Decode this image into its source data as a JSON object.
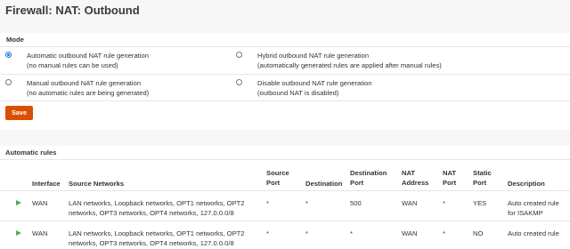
{
  "page": {
    "title": "Firewall: NAT: Outbound"
  },
  "mode": {
    "heading": "Mode",
    "options": [
      {
        "line1": "Automatic outbound NAT rule generation",
        "line2": "(no manual rules can be used)",
        "checked": true
      },
      {
        "line1": "Hybrid outbound NAT rule generation",
        "line2": "(automatically generated rules are applied after manual rules)",
        "checked": false
      },
      {
        "line1": "Manual outbound NAT rule generation",
        "line2": "(no automatic rules are being generated)",
        "checked": false
      },
      {
        "line1": "Disable outbound NAT rule generation",
        "line2": "(outbound NAT is disabled)",
        "checked": false
      }
    ],
    "save_label": "Save"
  },
  "rules": {
    "heading": "Automatic rules",
    "columns": {
      "interface": "Interface",
      "source_networks": "Source Networks",
      "source_port_1": "Source",
      "source_port_2": "Port",
      "destination": "Destination",
      "destination_port_1": "Destination",
      "destination_port_2": "Port",
      "nat_address_1": "NAT",
      "nat_address_2": "Address",
      "nat_port_1": "NAT",
      "nat_port_2": "Port",
      "static_port_1": "Static",
      "static_port_2": "Port",
      "description": "Description"
    },
    "rows": [
      {
        "interface": "WAN",
        "source_line1": "LAN networks, Loopback networks, OPT1 networks, OPT2",
        "source_line2": "networks, OPT3 networks, OPT4 networks, 127.0.0.0/8",
        "source_port": "*",
        "destination": "*",
        "destination_port": "500",
        "nat_address": "WAN",
        "nat_port": "*",
        "static_port": "YES",
        "description_line1": "Auto created rule",
        "description_line2": "for ISAKMP"
      },
      {
        "interface": "WAN",
        "source_line1": "LAN networks, Loopback networks, OPT1 networks, OPT2",
        "source_line2": "networks, OPT3 networks, OPT4 networks, 127.0.0.0/8",
        "source_port": "*",
        "destination": "*",
        "destination_port": "*",
        "nat_address": "WAN",
        "nat_port": "*",
        "static_port": "NO",
        "description_line1": "Auto created rule",
        "description_line2": ""
      }
    ],
    "enabled_icon": "play-icon",
    "icon_color": "#4caf50"
  },
  "colors": {
    "accent": "#d94f00",
    "radio": "#1e73d8"
  }
}
